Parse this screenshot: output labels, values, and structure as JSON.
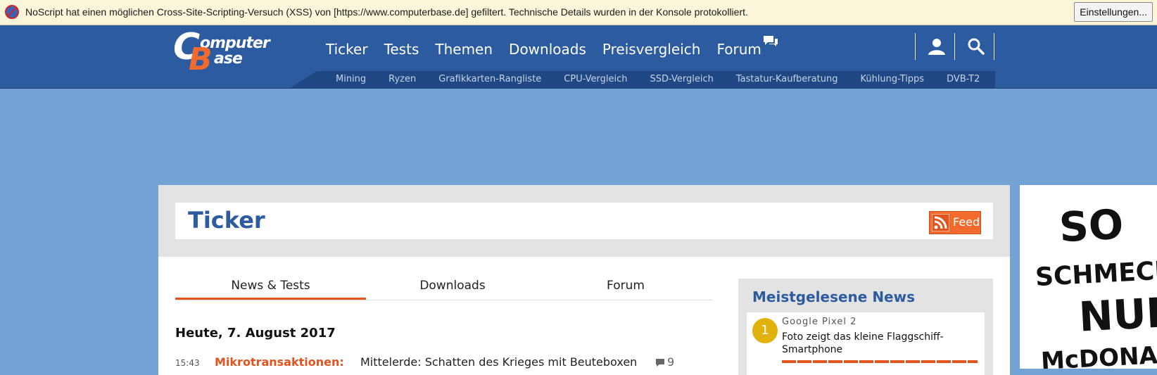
{
  "noscript": {
    "message": "NoScript hat einen möglichen Cross-Site-Scripting-Versuch (XSS) von [https://www.computerbase.de] gefiltert. Technische Details wurden in der Konsole protokolliert.",
    "settings_button": "Einstellungen...",
    "icon": "noscript-icon"
  },
  "logo": {
    "c": "C",
    "b": "B",
    "word1": "omputer",
    "word2": "ase"
  },
  "main_nav": [
    "Ticker",
    "Tests",
    "Themen",
    "Downloads",
    "Preisvergleich",
    "Forum"
  ],
  "sub_nav": [
    "Mining",
    "Ryzen",
    "Grafikkarten-Rangliste",
    "CPU-Vergleich",
    "SSD-Vergleich",
    "Tastatur-Kaufberatung",
    "Kühlung-Tipps",
    "DVB-T2"
  ],
  "header_icons": [
    "user-icon",
    "search-icon"
  ],
  "ticker": {
    "title": "Ticker",
    "feed_label": "Feed"
  },
  "tabs": [
    "News & Tests",
    "Downloads",
    "Forum"
  ],
  "day_heading": "Heute, 7. August 2017",
  "news": [
    {
      "time": "15:43",
      "kicker": "Mikrotransaktionen:",
      "headline": "Mittelerde: Schatten des Krieges mit Beuteboxen",
      "comments": "9"
    }
  ],
  "most_read": {
    "title": "Meistgelesene News",
    "items": [
      {
        "rank": "1",
        "kicker": "Google Pixel 2",
        "headline": "Foto zeigt das kleine Flaggschiff-Smartphone"
      }
    ]
  },
  "ad": {
    "lines": [
      "SO",
      "SCHMECK",
      "NUR",
      "McDONAL"
    ]
  },
  "colors": {
    "brand_blue": "#2c5ba0",
    "accent_orange": "#e2541d",
    "page_bg": "#72a3d4",
    "rank_gold": "#e2b20c"
  }
}
